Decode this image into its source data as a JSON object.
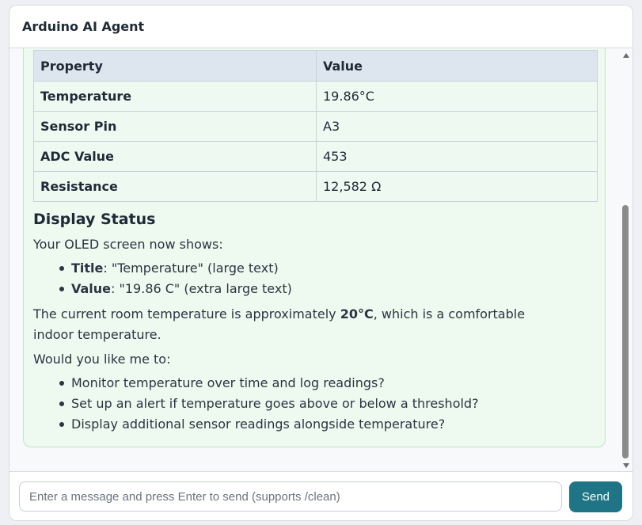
{
  "header": {
    "title": "Arduino AI Agent"
  },
  "table": {
    "headers": [
      "Property",
      "Value"
    ],
    "rows": [
      {
        "property": "Temperature",
        "value": "19.86°C"
      },
      {
        "property": "Sensor Pin",
        "value": "A3"
      },
      {
        "property": "ADC Value",
        "value": "453"
      },
      {
        "property": "Resistance",
        "value": "12,582 Ω"
      }
    ]
  },
  "display_status": {
    "heading": "Display Status",
    "intro": "Your OLED screen now shows:",
    "items": [
      {
        "label": "Title",
        "text": ": \"Temperature\" (large text)"
      },
      {
        "label": "Value",
        "text": ": \"19.86 C\" (extra large text)"
      }
    ]
  },
  "summary": {
    "before": "The current room temperature is approximately ",
    "bold": "20°C",
    "after": ", which is a comfortable indoor temperature."
  },
  "followup": {
    "question": "Would you like me to:",
    "options": [
      "Monitor temperature over time and log readings?",
      "Set up an alert if temperature goes above or below a threshold?",
      "Display additional sensor readings alongside temperature?"
    ]
  },
  "input": {
    "placeholder": "Enter a message and press Enter to send (supports /clean)",
    "value": ""
  },
  "send_button": {
    "label": "Send"
  },
  "colors": {
    "send_button": "#1f7585",
    "message_bg": "#eefaf0",
    "message_border": "#bfe5c6",
    "table_header_bg": "#dde5ef"
  }
}
